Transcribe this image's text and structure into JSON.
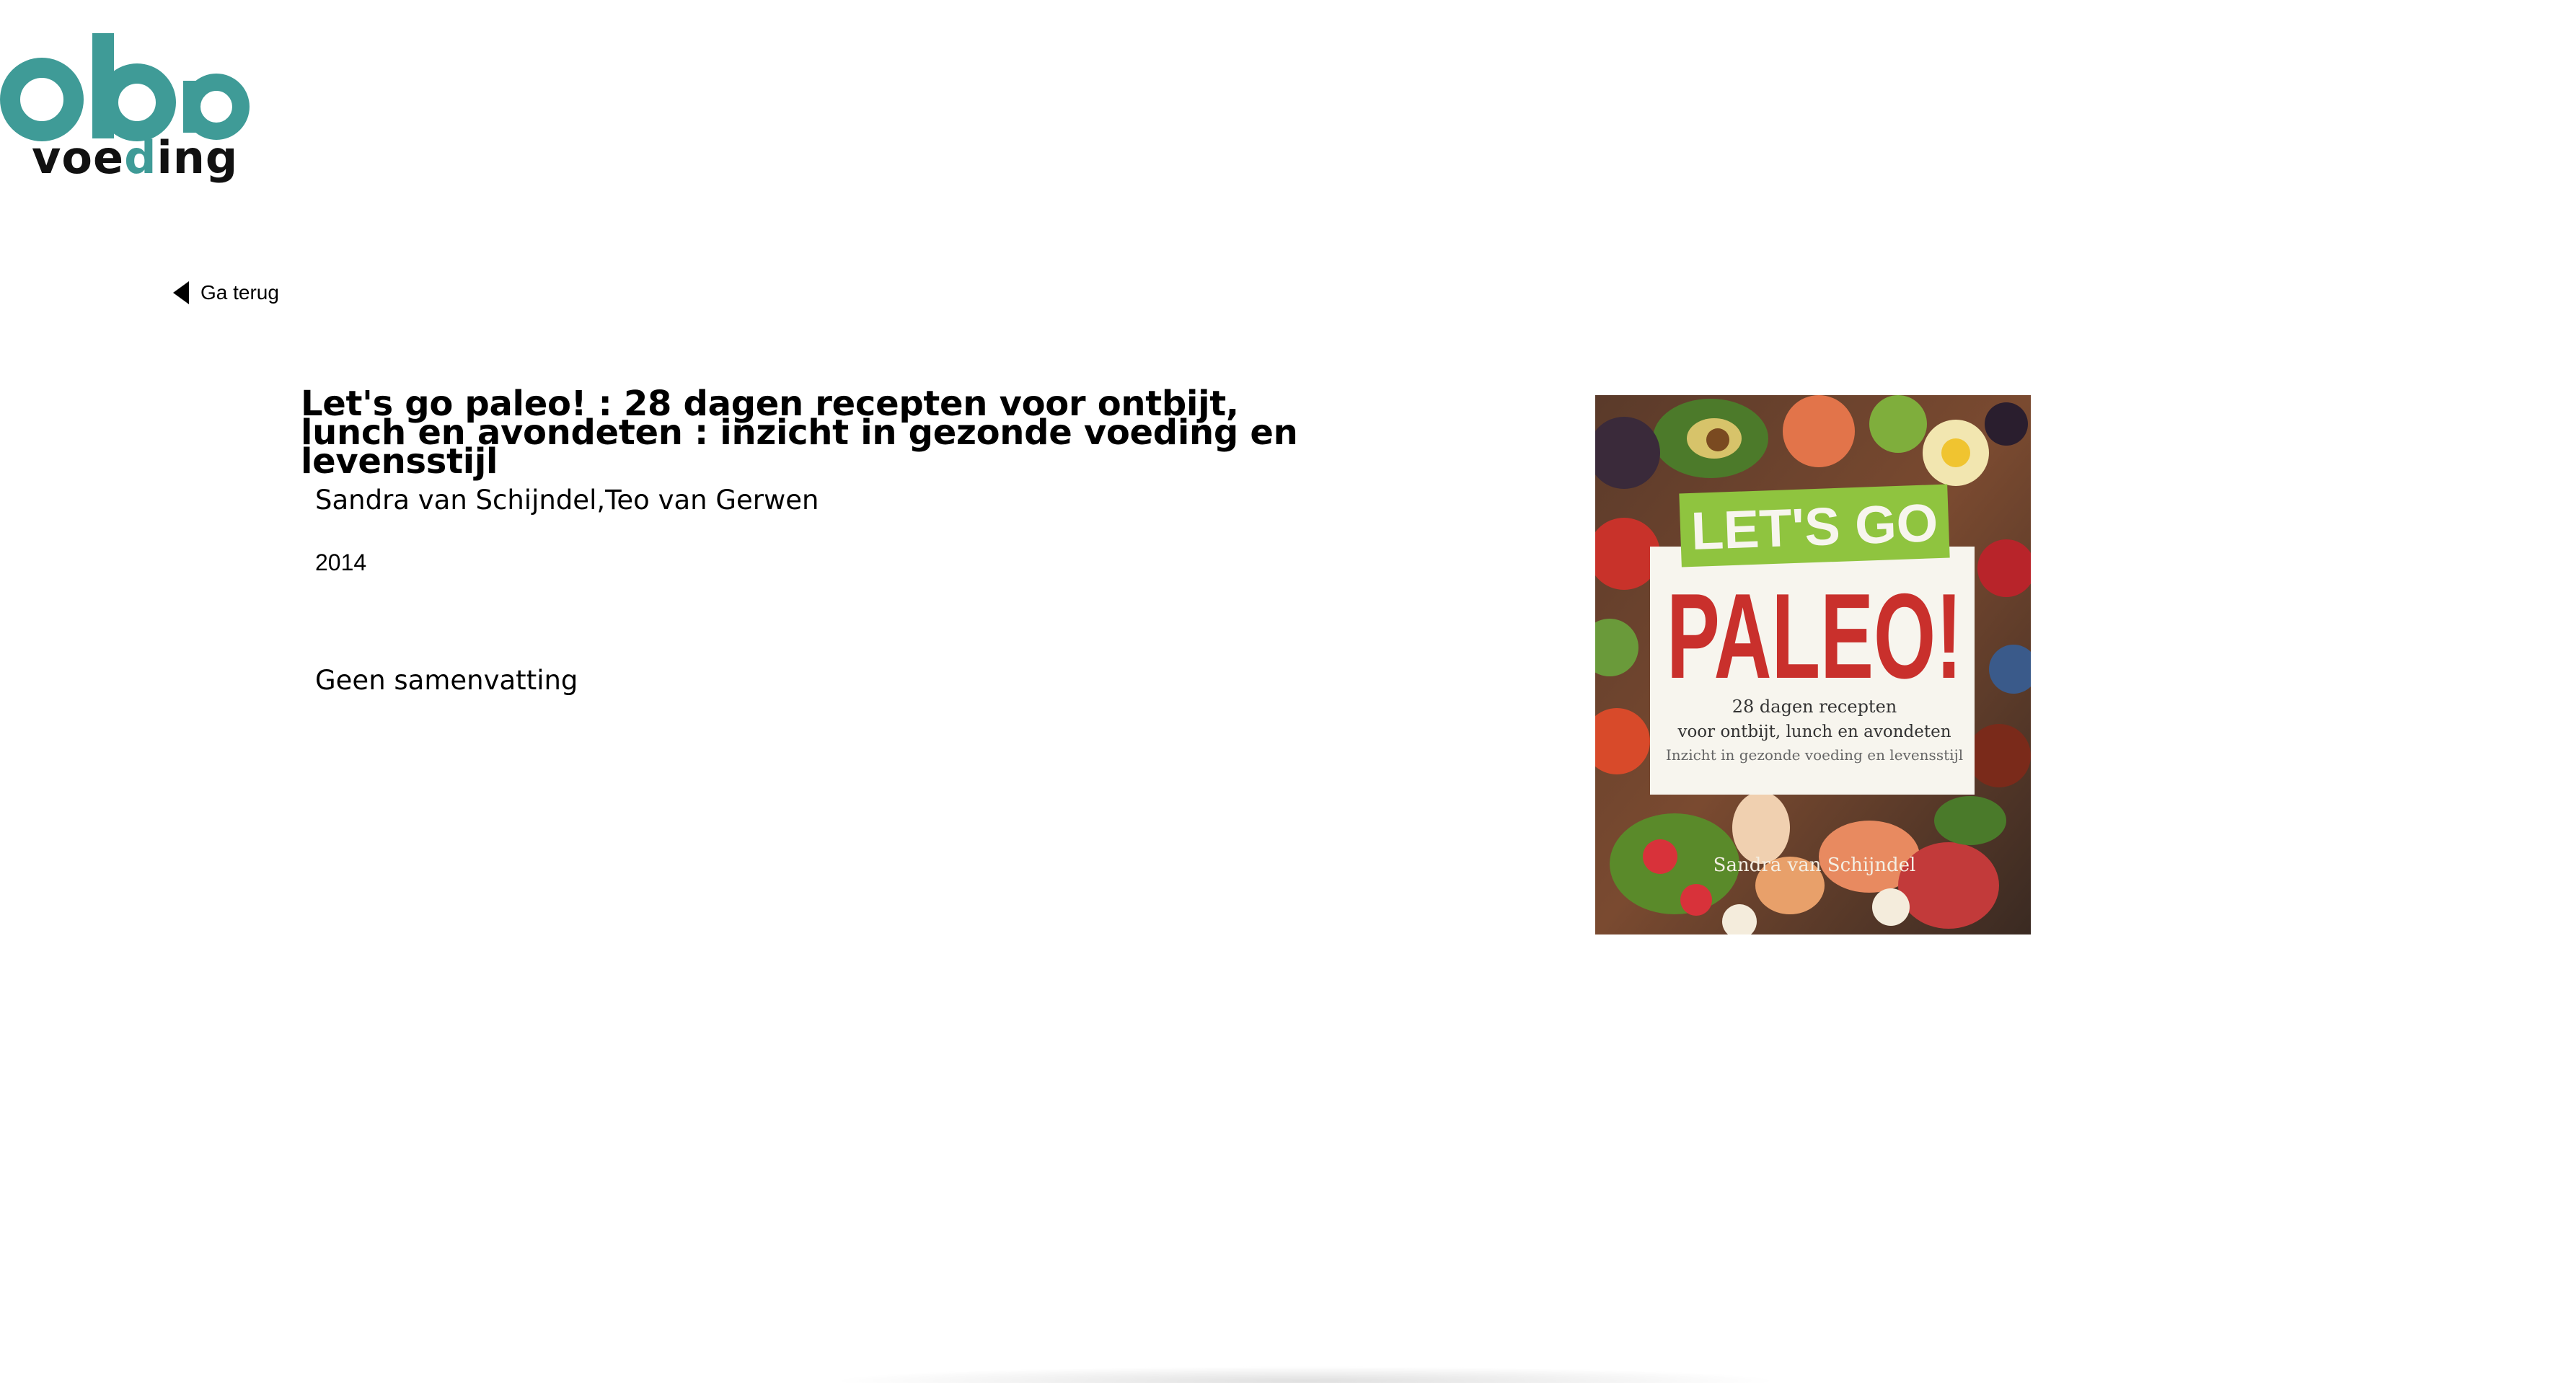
{
  "brand": {
    "logo_letters": "oba",
    "logo_word_before": "voe",
    "logo_word_accent": "d",
    "logo_word_after": "ing",
    "accent_color": "#3f9b97"
  },
  "nav": {
    "back_label": "Ga terug",
    "back_icon": "triangle-left-icon"
  },
  "book": {
    "title": "Let's go paleo! : 28 dagen recepten voor ontbijt, lunch en avondeten : inzicht in gezonde voeding en levensstijl",
    "authors": "Sandra van Schijndel,Teo van Gerwen",
    "year": "2014",
    "summary": "Geen samenvatting",
    "cover": {
      "banner": "LET'S GO",
      "headline": "PALEO!",
      "sub_line1": "28 dagen recepten",
      "sub_line2": "voor ontbijt, lunch en avondeten",
      "sub_line3": "Inzicht in gezonde voeding en levensstijl",
      "author": "Sandra van Schijndel",
      "banner_color": "#8fc43f",
      "headline_color": "#c9302c"
    }
  }
}
